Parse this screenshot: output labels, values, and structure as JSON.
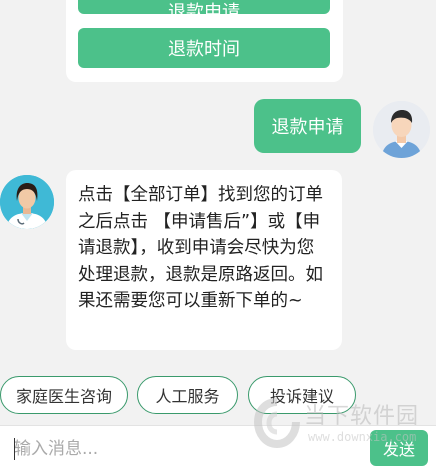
{
  "menu": {
    "item_1_label": "退款申请",
    "item_2_label": "退款时间"
  },
  "user_message": {
    "text": "退款申请"
  },
  "doctor_message": {
    "text": "点击【全部订单】找到您的订单之后点击 【申请售后”】或【申请退款】，收到申请会尽快为您处理退款，退款是原路返回。如果还需要您可以重新下单的~"
  },
  "quick_replies": {
    "items": [
      "家庭医生咨询",
      "人工服务",
      "投诉建议"
    ]
  },
  "composer": {
    "placeholder": "输入消息...",
    "send_label": "发送"
  },
  "watermark": {
    "name": "当下软件园",
    "url": "www.downxia.com"
  },
  "colors": {
    "accent": "#4cc18a",
    "chip_border": "#3a9a6c",
    "background": "#f2f2f2"
  }
}
